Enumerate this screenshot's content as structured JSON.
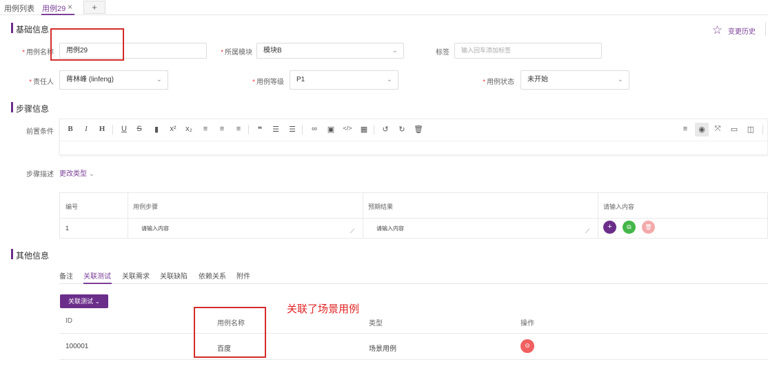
{
  "tabs": {
    "list_label": "用例列表",
    "active_label": "用例29",
    "close": "×",
    "add": "+"
  },
  "history_label": "变更历史",
  "sections": {
    "basic": "基础信息",
    "steps": "步骤信息",
    "other": "其他信息"
  },
  "basic": {
    "name_label": "用例名称",
    "name_value": "用例29",
    "module_label": "所属模块",
    "module_value": "模块B",
    "tag_label": "标签",
    "tag_placeholder": "输入回车添加标签",
    "owner_label": "责任人",
    "owner_value": "蒋林峰 (linfeng)",
    "level_label": "用例等级",
    "level_value": "P1",
    "status_label": "用例状态",
    "status_value": "未开始",
    "required_mark": "*"
  },
  "steps": {
    "precondition_label": "前置条件",
    "desc_label": "步骤描述",
    "change_type": "更改类型",
    "headers": [
      "编号",
      "用例步骤",
      "预期结果",
      "请输入内容"
    ],
    "row": {
      "num": "1",
      "step_placeholder": "请输入内容",
      "result_placeholder": "请输入内容"
    },
    "actions": [
      "+",
      "⧉",
      "🗑"
    ]
  },
  "other": {
    "subtabs": [
      "备注",
      "关联测试",
      "关联需求",
      "关联缺陷",
      "依赖关系",
      "附件"
    ],
    "assoc_button": "关联测试 ⌄",
    "headers": [
      "ID",
      "用例名称",
      "类型",
      "操作"
    ],
    "rows": [
      {
        "id": "100001",
        "name": "百度",
        "type": "场景用例"
      }
    ]
  },
  "annotation_text": "关联了场景用例",
  "colors": {
    "accent": "#7b3f98",
    "annotation": "#e02424",
    "add_btn": "#6b2d8a",
    "copy_btn": "#45b649",
    "delete_btn": "#f4aaaa",
    "delete_row_btn": "#f06060"
  },
  "toolbar_icons": [
    "bold-icon",
    "italic-icon",
    "heading-icon",
    "underline-icon",
    "strikethrough-icon",
    "bookmark-icon",
    "superscript-icon",
    "subscript-icon",
    "align-left-icon",
    "align-center-icon",
    "align-right-icon",
    "quote-icon",
    "ordered-list-icon",
    "unordered-list-icon",
    "link-icon",
    "image-icon",
    "code-icon",
    "table-icon",
    "undo-icon",
    "redo-icon",
    "trash-icon",
    "menu-icon",
    "eye-icon",
    "fullscreen-icon",
    "window-icon",
    "split-icon"
  ]
}
